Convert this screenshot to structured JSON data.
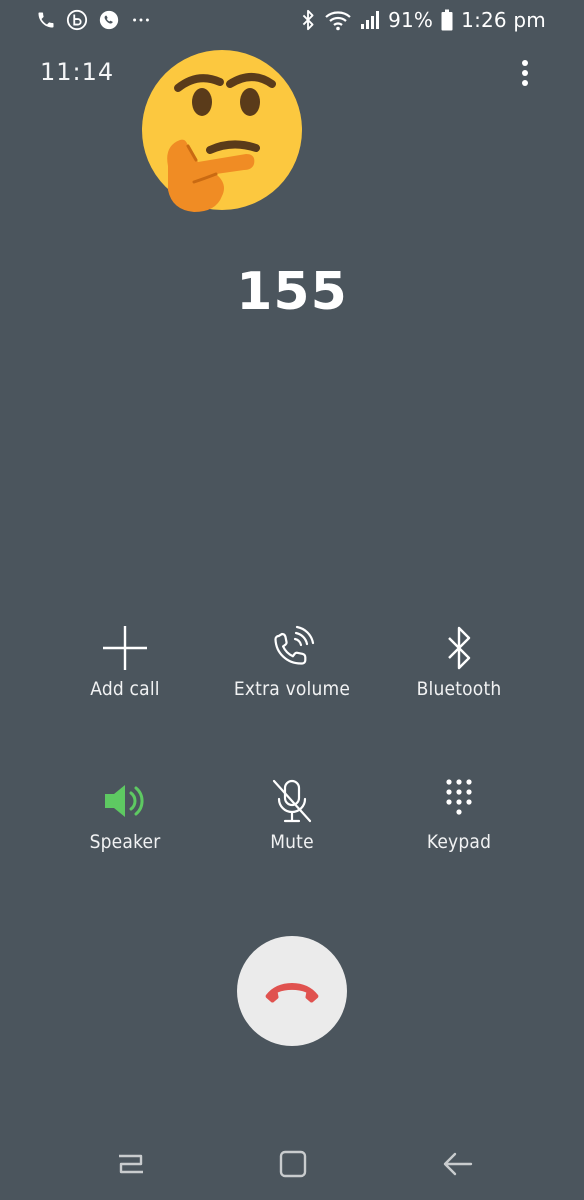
{
  "status_bar": {
    "battery": "91%",
    "time": "1:26 pm",
    "left_icons": [
      "phone-icon",
      "app-b-icon",
      "whatsapp-icon",
      "more-notifications-icon"
    ],
    "right_icons": [
      "bluetooth-icon",
      "wifi-icon",
      "signal-icon",
      "battery-icon"
    ]
  },
  "call": {
    "duration": "11:14",
    "number": "155",
    "contact_image": "thinking-face-emoji"
  },
  "controls": [
    {
      "label": "Add call",
      "icon": "plus-icon",
      "active": false
    },
    {
      "label": "Extra volume",
      "icon": "phone-volume-icon",
      "active": false
    },
    {
      "label": "Bluetooth",
      "icon": "bluetooth-icon",
      "active": false
    },
    {
      "label": "Speaker",
      "icon": "speaker-icon",
      "active": true
    },
    {
      "label": "Mute",
      "icon": "mic-off-icon",
      "active": false
    },
    {
      "label": "Keypad",
      "icon": "keypad-icon",
      "active": false
    }
  ],
  "end_call": {
    "icon": "hang-up-icon",
    "color": "#e0524f",
    "background": "#ebebeb"
  },
  "navigation": [
    "recents-icon",
    "home-icon",
    "back-icon"
  ],
  "colors": {
    "background": "#4b555d",
    "speaker_active": "#5ec962",
    "end_call_red": "#e0524f"
  }
}
